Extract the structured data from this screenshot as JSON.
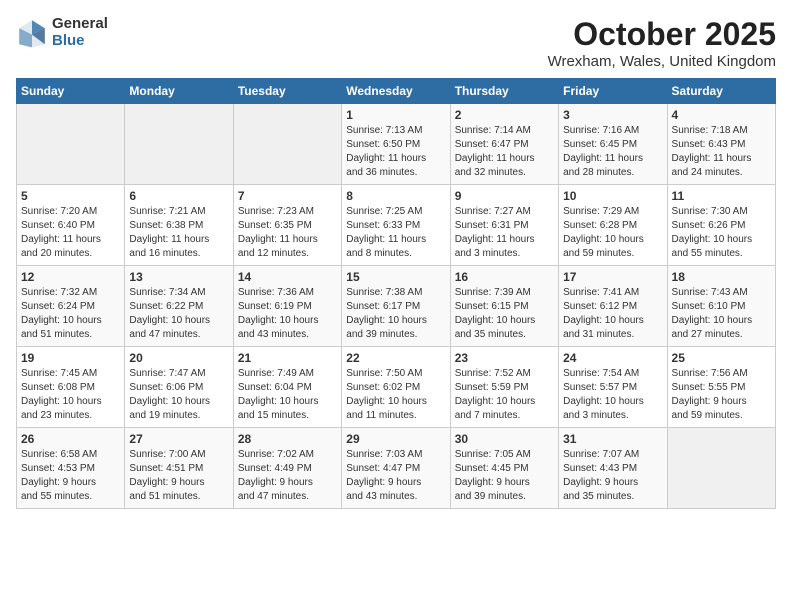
{
  "header": {
    "logo_general": "General",
    "logo_blue": "Blue",
    "month_title": "October 2025",
    "location": "Wrexham, Wales, United Kingdom"
  },
  "days_of_week": [
    "Sunday",
    "Monday",
    "Tuesday",
    "Wednesday",
    "Thursday",
    "Friday",
    "Saturday"
  ],
  "weeks": [
    [
      {
        "day": "",
        "info": ""
      },
      {
        "day": "",
        "info": ""
      },
      {
        "day": "",
        "info": ""
      },
      {
        "day": "1",
        "info": "Sunrise: 7:13 AM\nSunset: 6:50 PM\nDaylight: 11 hours\nand 36 minutes."
      },
      {
        "day": "2",
        "info": "Sunrise: 7:14 AM\nSunset: 6:47 PM\nDaylight: 11 hours\nand 32 minutes."
      },
      {
        "day": "3",
        "info": "Sunrise: 7:16 AM\nSunset: 6:45 PM\nDaylight: 11 hours\nand 28 minutes."
      },
      {
        "day": "4",
        "info": "Sunrise: 7:18 AM\nSunset: 6:43 PM\nDaylight: 11 hours\nand 24 minutes."
      }
    ],
    [
      {
        "day": "5",
        "info": "Sunrise: 7:20 AM\nSunset: 6:40 PM\nDaylight: 11 hours\nand 20 minutes."
      },
      {
        "day": "6",
        "info": "Sunrise: 7:21 AM\nSunset: 6:38 PM\nDaylight: 11 hours\nand 16 minutes."
      },
      {
        "day": "7",
        "info": "Sunrise: 7:23 AM\nSunset: 6:35 PM\nDaylight: 11 hours\nand 12 minutes."
      },
      {
        "day": "8",
        "info": "Sunrise: 7:25 AM\nSunset: 6:33 PM\nDaylight: 11 hours\nand 8 minutes."
      },
      {
        "day": "9",
        "info": "Sunrise: 7:27 AM\nSunset: 6:31 PM\nDaylight: 11 hours\nand 3 minutes."
      },
      {
        "day": "10",
        "info": "Sunrise: 7:29 AM\nSunset: 6:28 PM\nDaylight: 10 hours\nand 59 minutes."
      },
      {
        "day": "11",
        "info": "Sunrise: 7:30 AM\nSunset: 6:26 PM\nDaylight: 10 hours\nand 55 minutes."
      }
    ],
    [
      {
        "day": "12",
        "info": "Sunrise: 7:32 AM\nSunset: 6:24 PM\nDaylight: 10 hours\nand 51 minutes."
      },
      {
        "day": "13",
        "info": "Sunrise: 7:34 AM\nSunset: 6:22 PM\nDaylight: 10 hours\nand 47 minutes."
      },
      {
        "day": "14",
        "info": "Sunrise: 7:36 AM\nSunset: 6:19 PM\nDaylight: 10 hours\nand 43 minutes."
      },
      {
        "day": "15",
        "info": "Sunrise: 7:38 AM\nSunset: 6:17 PM\nDaylight: 10 hours\nand 39 minutes."
      },
      {
        "day": "16",
        "info": "Sunrise: 7:39 AM\nSunset: 6:15 PM\nDaylight: 10 hours\nand 35 minutes."
      },
      {
        "day": "17",
        "info": "Sunrise: 7:41 AM\nSunset: 6:12 PM\nDaylight: 10 hours\nand 31 minutes."
      },
      {
        "day": "18",
        "info": "Sunrise: 7:43 AM\nSunset: 6:10 PM\nDaylight: 10 hours\nand 27 minutes."
      }
    ],
    [
      {
        "day": "19",
        "info": "Sunrise: 7:45 AM\nSunset: 6:08 PM\nDaylight: 10 hours\nand 23 minutes."
      },
      {
        "day": "20",
        "info": "Sunrise: 7:47 AM\nSunset: 6:06 PM\nDaylight: 10 hours\nand 19 minutes."
      },
      {
        "day": "21",
        "info": "Sunrise: 7:49 AM\nSunset: 6:04 PM\nDaylight: 10 hours\nand 15 minutes."
      },
      {
        "day": "22",
        "info": "Sunrise: 7:50 AM\nSunset: 6:02 PM\nDaylight: 10 hours\nand 11 minutes."
      },
      {
        "day": "23",
        "info": "Sunrise: 7:52 AM\nSunset: 5:59 PM\nDaylight: 10 hours\nand 7 minutes."
      },
      {
        "day": "24",
        "info": "Sunrise: 7:54 AM\nSunset: 5:57 PM\nDaylight: 10 hours\nand 3 minutes."
      },
      {
        "day": "25",
        "info": "Sunrise: 7:56 AM\nSunset: 5:55 PM\nDaylight: 9 hours\nand 59 minutes."
      }
    ],
    [
      {
        "day": "26",
        "info": "Sunrise: 6:58 AM\nSunset: 4:53 PM\nDaylight: 9 hours\nand 55 minutes."
      },
      {
        "day": "27",
        "info": "Sunrise: 7:00 AM\nSunset: 4:51 PM\nDaylight: 9 hours\nand 51 minutes."
      },
      {
        "day": "28",
        "info": "Sunrise: 7:02 AM\nSunset: 4:49 PM\nDaylight: 9 hours\nand 47 minutes."
      },
      {
        "day": "29",
        "info": "Sunrise: 7:03 AM\nSunset: 4:47 PM\nDaylight: 9 hours\nand 43 minutes."
      },
      {
        "day": "30",
        "info": "Sunrise: 7:05 AM\nSunset: 4:45 PM\nDaylight: 9 hours\nand 39 minutes."
      },
      {
        "day": "31",
        "info": "Sunrise: 7:07 AM\nSunset: 4:43 PM\nDaylight: 9 hours\nand 35 minutes."
      },
      {
        "day": "",
        "info": ""
      }
    ]
  ]
}
